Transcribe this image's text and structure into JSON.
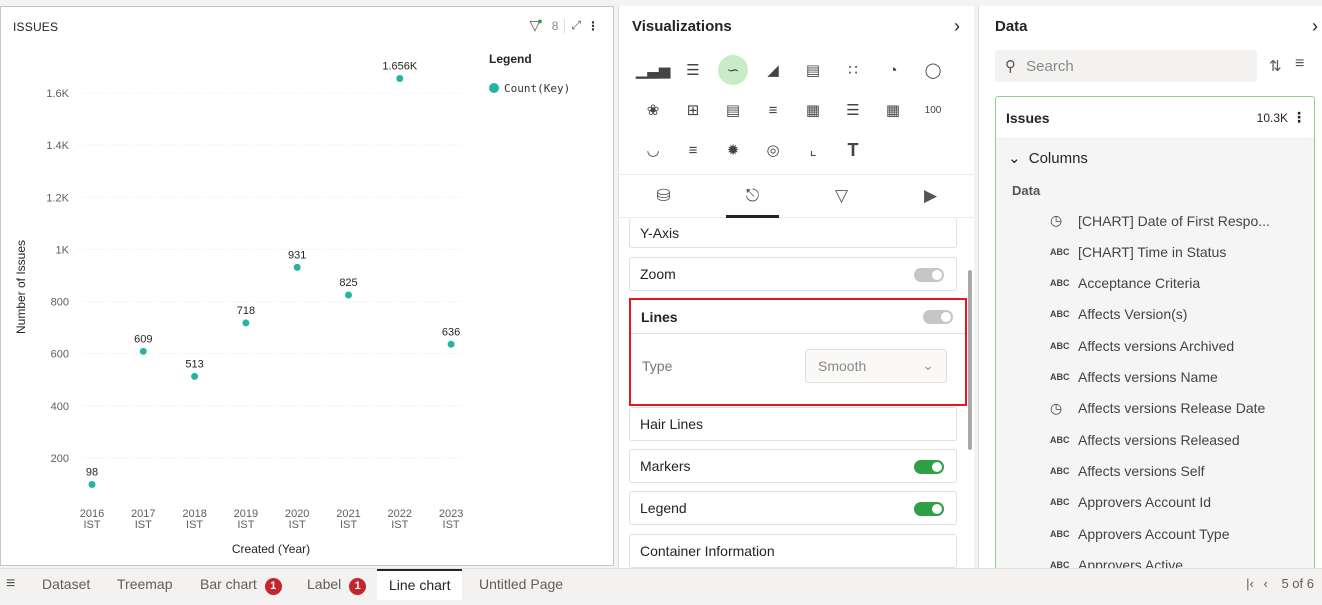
{
  "chart_card": {
    "title": "ISSUES",
    "filter_count": "8"
  },
  "chart_data": {
    "type": "scatter",
    "categories": [
      "2016\nIST",
      "2017\nIST",
      "2018\nIST",
      "2019\nIST",
      "2020\nIST",
      "2021\nIST",
      "2022\nIST",
      "2023\nIST"
    ],
    "series": [
      {
        "name": "Count(Key)",
        "values": [
          98,
          609,
          513,
          718,
          931,
          825,
          1656,
          636
        ],
        "labels": [
          "98",
          "609",
          "513",
          "718",
          "931",
          "825",
          "1.656K",
          "636"
        ]
      }
    ],
    "title": "",
    "xlabel": "Created (Year)",
    "ylabel": "Number of Issues",
    "yticks": [
      200,
      400,
      600,
      800,
      1000,
      1200,
      1400,
      1600
    ],
    "ytick_labels": [
      "200",
      "400",
      "600",
      "800",
      "1K",
      "1.2K",
      "1.4K",
      "1.6K"
    ],
    "ylim": [
      50,
      1700
    ],
    "grid": true,
    "legend_title": "Legend",
    "legend_position": "top-right",
    "marker_color": "#26b3a6"
  },
  "visualizations": {
    "title": "Visualizations",
    "icons": [
      [
        "bar-chart",
        "column-chart",
        "line-chart",
        "area-chart",
        "combo-chart",
        "scatter-chart",
        "pie-chart",
        "donut-chart"
      ],
      [
        "radar-chart",
        "pivot-table",
        "table-view",
        "filter-table",
        "grid-table",
        "list-table",
        "tile-table",
        "number-kpi"
      ],
      [
        "gauge-chart",
        "funnel-chart",
        "network-chart",
        "map-globe",
        "step-chart",
        "text-label"
      ]
    ],
    "number_kpi_label": "100",
    "text_label": "T",
    "tabs": [
      "data-source-tab",
      "format-tab",
      "filter-tab",
      "analytics-tab"
    ],
    "sections": {
      "y_axis": "Y-Axis",
      "zoom": "Zoom",
      "lines": "Lines",
      "type_label": "Type",
      "type_value": "Smooth",
      "hair_lines": "Hair Lines",
      "markers": "Markers",
      "legend": "Legend",
      "container_info": "Container Information"
    }
  },
  "data_panel": {
    "title": "Data",
    "search_placeholder": "Search",
    "table_name": "Issues",
    "table_count": "10.3K",
    "columns_label": "Columns",
    "group_label": "Data",
    "fields": [
      {
        "type": "clock",
        "name": "[CHART] Date of First Respo..."
      },
      {
        "type": "ABC",
        "name": "[CHART] Time in Status"
      },
      {
        "type": "ABC",
        "name": "Acceptance Criteria"
      },
      {
        "type": "ABC",
        "name": "Affects Version(s)"
      },
      {
        "type": "ABC",
        "name": "Affects versions Archived"
      },
      {
        "type": "ABC",
        "name": "Affects versions Name"
      },
      {
        "type": "clock",
        "name": "Affects versions Release Date"
      },
      {
        "type": "ABC",
        "name": "Affects versions Released"
      },
      {
        "type": "ABC",
        "name": "Affects versions Self"
      },
      {
        "type": "ABC",
        "name": "Approvers Account Id"
      },
      {
        "type": "ABC",
        "name": "Approvers Account Type"
      },
      {
        "type": "ABC",
        "name": "Approvers Active"
      }
    ]
  },
  "page_tabs": {
    "tabs": [
      {
        "label": "Dataset",
        "badge": ""
      },
      {
        "label": "Treemap",
        "badge": ""
      },
      {
        "label": "Bar chart",
        "badge": "1"
      },
      {
        "label": "Label",
        "badge": "1"
      },
      {
        "label": "Line chart",
        "badge": ""
      },
      {
        "label": "Untitled Page",
        "badge": ""
      }
    ],
    "active_index": 4,
    "page_info": "5 of 6"
  }
}
